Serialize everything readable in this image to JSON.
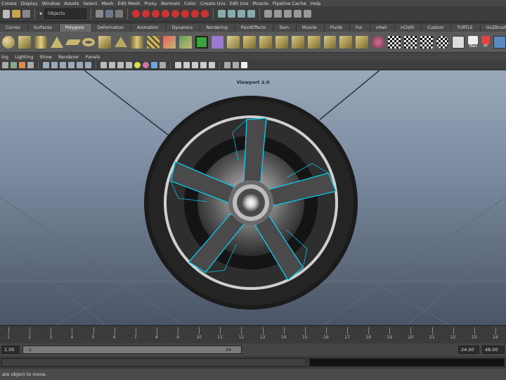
{
  "menubar": [
    "Create",
    "Display",
    "Window",
    "Assets",
    "Select",
    "Mesh",
    "Edit Mesh",
    "Proxy",
    "Normals",
    "Color",
    "Create Uvs",
    "Edit Uvs",
    "Muscle",
    "Pipeline Cache",
    "Help"
  ],
  "statusline": {
    "object_field": "Objects"
  },
  "shelf_tabs": [
    "Curves",
    "Surfaces",
    "Polygons",
    "Deformation",
    "Animation",
    "Dynamics",
    "Rendering",
    "PaintEffects",
    "Toon",
    "Muscle",
    "Fluids",
    "Fur",
    "nHair",
    "nCloth",
    "Custom",
    "TURTLE",
    "GoZBrush"
  ],
  "shelf_tabs_active": "Polygons",
  "shelf_extra_labels": {
    "mari": "Mari",
    "pt": "PT"
  },
  "panel_menu": [
    "ing",
    "Lighting",
    "Show",
    "Renderer",
    "Panels"
  ],
  "viewport": {
    "label": "Viewport 2.0"
  },
  "timeline": {
    "ticks": [
      "1",
      "2",
      "3",
      "4",
      "5",
      "6",
      "7",
      "8",
      "9",
      "10",
      "11",
      "12",
      "13",
      "14",
      "15",
      "16",
      "17",
      "18",
      "19",
      "20",
      "21",
      "22",
      "23",
      "24"
    ]
  },
  "range": {
    "start": "1.00",
    "inner_start": "1",
    "inner_end": "24",
    "end": "24.00",
    "anim_end": "48.00"
  },
  "helpline": {
    "text": "ate object to move."
  },
  "colors": {
    "accent": "#00d8ff",
    "wheel_tire": "#1a1a1a",
    "rim": "#3a3a3a",
    "viewport_top": "#9aa8bb"
  }
}
